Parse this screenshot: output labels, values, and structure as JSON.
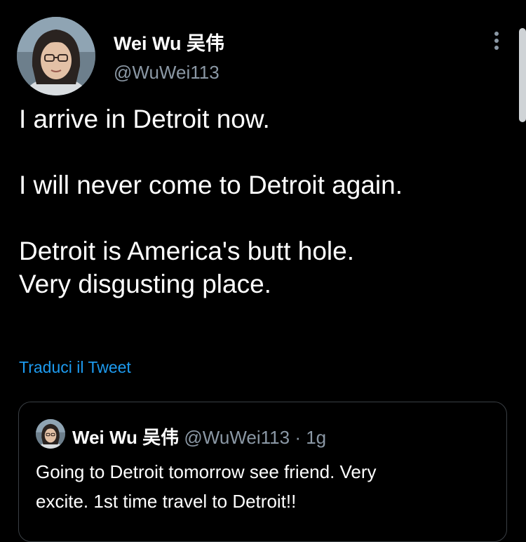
{
  "author": {
    "display_name": "Wei Wu 吴伟",
    "handle": "@WuWei113",
    "avatar_icon": "profile-photo"
  },
  "tweet": {
    "lines": [
      "I arrive in Detroit now.",
      "",
      "I will never come to Detroit again.",
      "",
      "Detroit is America's butt hole.",
      "Very disgusting place."
    ],
    "translate_label": "Traduci il Tweet",
    "more_icon": "more-vertical-icon"
  },
  "quoted_tweet": {
    "display_name": "Wei Wu 吴伟",
    "handle": "@WuWei113",
    "separator": "·",
    "age": "1g",
    "lines": [
      "Going to Detroit tomorrow see friend. Very",
      "excite. 1st time travel to Detroit!!"
    ]
  },
  "colors": {
    "background": "#000000",
    "text_primary": "#ffffff",
    "text_secondary": "#8b98a5",
    "link": "#1d9bf0",
    "border": "#3a3f44"
  }
}
